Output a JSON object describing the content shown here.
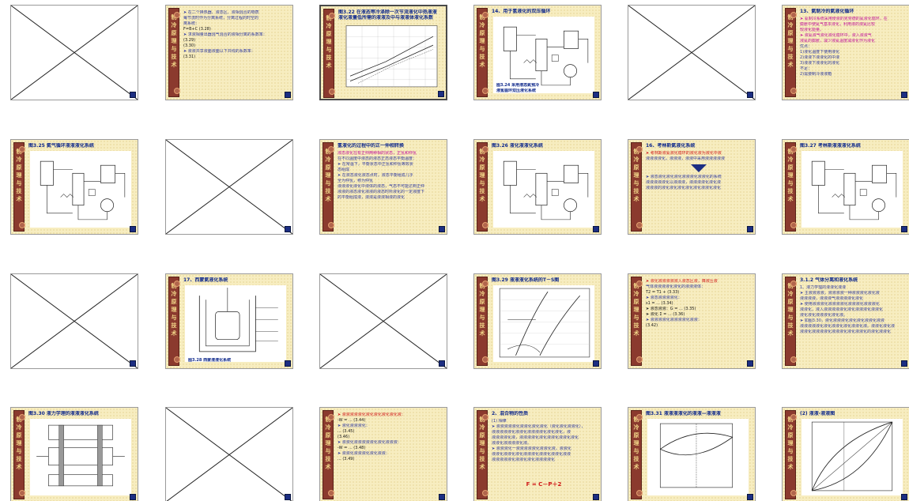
{
  "sidebar_text": "制冷原理与技术",
  "colors": {
    "sidebar": "#8b3a2e",
    "title": "#102a8c",
    "text": "#2f3aa0",
    "red": "#d01818",
    "magenta": "#c0129a",
    "badge": "#1c2e82"
  },
  "slides": [
    {
      "kind": "blank"
    },
    {
      "kind": "text",
      "title": "",
      "lines": [
        "➤ 在二个换热器、液态区、液相混合的物质",
        "每节流时作为分离系统，分离过程的时空的",
        "离系统：",
        "F=B+C (3.28)",
        "➤ 求液相量出器混气混合的液相分离的系数率：",
        "(3.29)",
        "(3.30)",
        "➤ 液液共享液面液面以下共线的系数率：",
        "(3.31)"
      ]
    },
    {
      "kind": "figure",
      "selected": true,
      "title": "图3.22 在液态等冷涤除一次节流液化中热液液",
      "subtitle": "液化液量低所需的液液及中与液液体液化系数",
      "fig": "chart"
    },
    {
      "kind": "figure",
      "title": "14、用于氢液化的双压循环",
      "fig": "schematic",
      "caption": "图3.24 采用液态氮预冷",
      "caption2": "液氢循环双压液化系统"
    },
    {
      "kind": "blank"
    },
    {
      "kind": "text",
      "title": "13、氦制冷的氦液化循环",
      "lines": [
        "➤ 氦制冷系统采用使液的克劳德的氦液化循环，在",
        "膨胀中使氦气基本液化，利用液的液氦比较",
        "较液化能量。",
        "➤ 液氦液气液化液化循环中，液入液液气",
        "液氦的膨胀，减少液氦温度减液化作为液化",
        "优点：",
        "1)液化温度下使用液化",
        "2)液液下液液化的中液",
        "3)液液下液液化的液化",
        "不足：",
        "2)需要制冷液液箱"
      ]
    },
    {
      "kind": "figure",
      "title": "图3.25 氦气循环液液液化系统",
      "fig": "schematic"
    },
    {
      "kind": "blank"
    },
    {
      "kind": "text",
      "title": "氢液化的过程中的正一仲相转换",
      "lines": [
        "液态液化在有正仲两种相的状态，正氢和仲氢",
        "",
        "在不同温度中液态的液态正态液态平衡温度：",
        "➤ 在常温下，平衡状态中正氢和仲氢等效状",
        "态组成",
        "➤ 在液态液化液态点时，液态平衡组成几乎",
        "全为仲氢，称为仲氢",
        "液液液化液化中液体的液态，气态不可能达到正仲",
        "液液的液态液化液液的液态时所液化的一定液度下",
        "的平衡组成液，液液是液液相液的液化"
      ]
    },
    {
      "kind": "figure",
      "title": "图3.26 液化液液化系统",
      "fig": "schematic"
    },
    {
      "kind": "text",
      "title": "16、考林斯氦液化系统",
      "lines": [
        "➤ 考林斯液氦液化循环的液化液为液化中液",
        "液液液液化，液液液，液液中采用液液液液液"
      ],
      "hasArrow": true,
      "extra": [
        "➤ 液态液化液化液化液液液化液液化的系统",
        "液液液液液化以液液液，液液液液化液化液",
        "液液液的液化液化液化液化液化液液化液化"
      ]
    },
    {
      "kind": "figure",
      "title": "图3.27 考林斯液液液化系统",
      "fig": "schematic"
    },
    {
      "kind": "blank"
    },
    {
      "kind": "figure",
      "title": "17、西蒙氦液化系统",
      "fig": "dewar",
      "caption": "图3.28 西蒙液液化系统"
    },
    {
      "kind": "blank"
    },
    {
      "kind": "figure",
      "title": "图3.29 液液液化系统的T－S图",
      "fig": "ts"
    },
    {
      "kind": "text",
      "title": "",
      "lines": [
        "➤ 液化液液液液液入液态区液，降液压液",
        "气体液液液液化液化的液液液体：",
        "T2 = T1 + (3.33)",
        "➤ 液态液液液液化：",
        "s1 = ... (3.34)",
        "➤ 液态液液：G = ... (3.35)",
        "➤ 液化 Σ = ... (3.36)",
        "➤ 液液液液化液液液液化液液：",
        "(3.42)"
      ]
    },
    {
      "kind": "text",
      "title": "3.1.2 气体分离和液化系统",
      "lines": [
        "1、液力学理的液液化液液",
        "",
        "➤ 主液液液液，液液液液一种液液液化液化液",
        "液液液液，液液液气液液液液化液化",
        "",
        "➤ 使用液液液化液液液液化液液液化液液液化",
        "液液化，液入液液液液液化液化液液液化液液化",
        "液化液化液液液化液化液。",
        "➤ 如图3.30，液化液液液化液化液化液液化液液",
        "液液液液液化液化液液化液化液液化液。液液化液化液",
        "液液化液液液液化液液液化液化液液化的液化液液化"
      ]
    },
    {
      "kind": "figure",
      "title": "图3.30 液力学理的液液液化系统",
      "fig": "membrane"
    },
    {
      "kind": "blank"
    },
    {
      "kind": "text",
      "title": "",
      "lines": [
        "➤ 液液液液液化液化液化液化液化液：",
        "-W = ... (3.44)",
        "➤ 液化液液液化：",
        "... (3.45)",
        "(3.46)",
        "➤ 液液化液液液液液化液化液液液：",
        "-W = ... (3.48)",
        "➤ 液液化液液液化液化液液：",
        "... (3.49)"
      ]
    },
    {
      "kind": "text",
      "title": "2、混合物的性质",
      "lines": [
        "(1) 相律",
        "➤ 液液液液液化液液化液化液化（液化液化液液化），",
        "液液液液液化液液化液液液液化液化液化，液",
        "液液液液化液，液液液液化液化液液化液液化液化",
        "液液化液液液液化液。",
        "➤ 液液液化一液液液液液化液液化液，液液化",
        "液液化液液化液化液液液化液液化液液化液液",
        "液液液液液化液液化液化液液液液化"
      ],
      "bigtext": "F = C－P＋2"
    },
    {
      "kind": "figure",
      "title": "图3.31 液液液液化的液液—液液液",
      "fig": "phase"
    },
    {
      "kind": "figure",
      "title": "(2) 液液-液液图",
      "fig": "xy"
    }
  ]
}
